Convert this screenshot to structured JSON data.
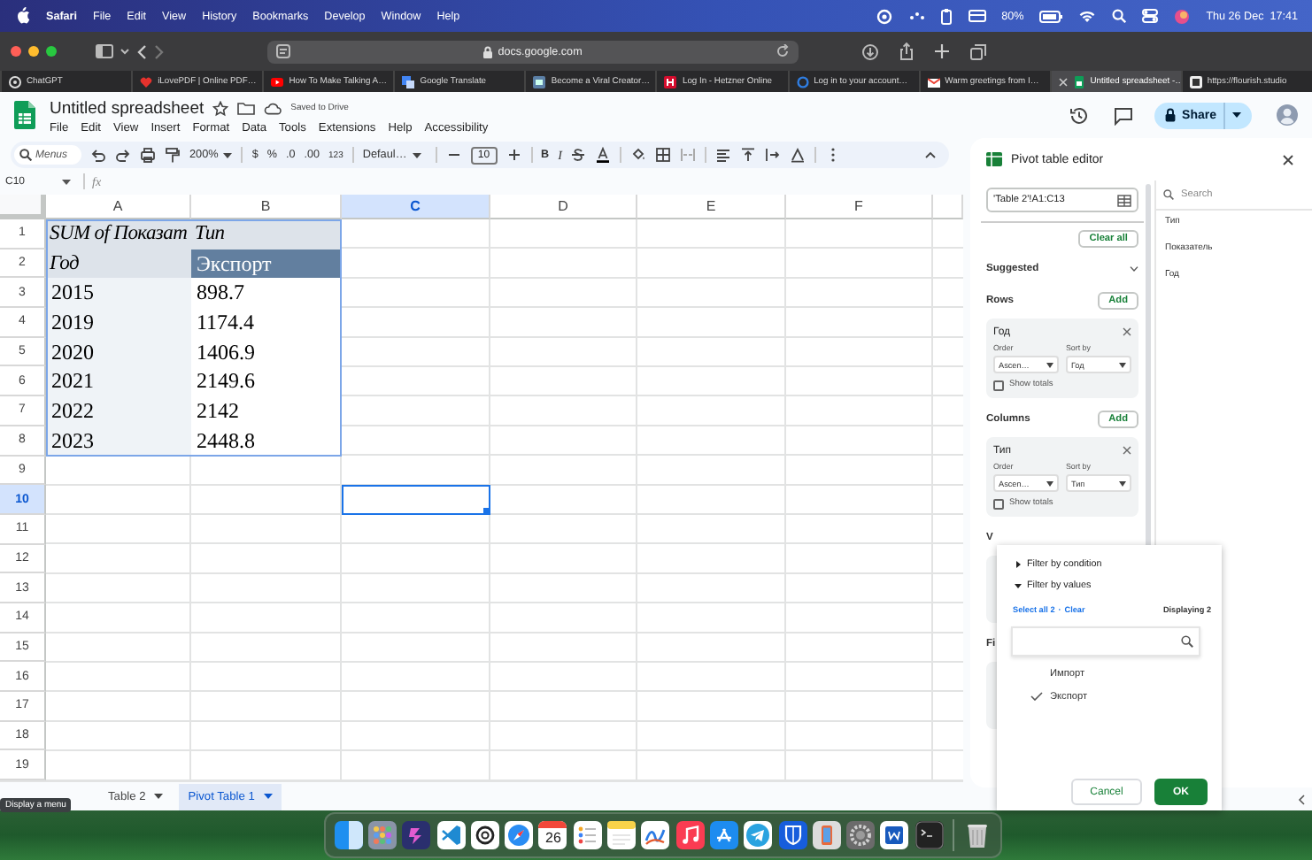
{
  "menu_bar": {
    "app": "Safari",
    "items": [
      "File",
      "Edit",
      "View",
      "History",
      "Bookmarks",
      "Develop",
      "Window",
      "Help"
    ],
    "battery": "80%",
    "clock": "Thu 26 Dec  17:41"
  },
  "browser": {
    "url": "docs.google.com",
    "tabs": [
      {
        "title": "ChatGPT",
        "selected": false
      },
      {
        "title": "iLovePDF | Online PDF…",
        "selected": false
      },
      {
        "title": "How To Make Talking A…",
        "selected": false
      },
      {
        "title": "Google Translate",
        "selected": false
      },
      {
        "title": "Become a Viral Creator…",
        "selected": false
      },
      {
        "title": "Log In - Hetzner Online",
        "selected": false
      },
      {
        "title": "Log in to your account…",
        "selected": false
      },
      {
        "title": "Warm greetings from I…",
        "selected": false
      },
      {
        "title": "Untitled spreadsheet -…",
        "selected": true
      },
      {
        "title": "https://flourish.studio",
        "selected": false
      }
    ]
  },
  "document": {
    "title": "Untitled spreadsheet",
    "save_status": "Saved to Drive",
    "menu": [
      "File",
      "Edit",
      "View",
      "Insert",
      "Format",
      "Data",
      "Tools",
      "Extensions",
      "Help",
      "Accessibility"
    ],
    "share": "Share"
  },
  "toolbar": {
    "search_placeholder": "Menus",
    "zoom": "200%",
    "currency": "$",
    "percent": "%",
    "decrease_decimals": ".0",
    "increase_decimals": ".00",
    "number_format": "123",
    "font": "Defaul…",
    "font_size": "10",
    "bold": "B",
    "italic": "I"
  },
  "formula_bar": {
    "cell_ref": "C10",
    "fx": "fx"
  },
  "grid": {
    "columns": [
      {
        "label": "A",
        "selected": false
      },
      {
        "label": "B",
        "selected": false
      },
      {
        "label": "C",
        "selected": true
      },
      {
        "label": "D",
        "selected": false
      },
      {
        "label": "E",
        "selected": false
      },
      {
        "label": "F",
        "selected": false
      }
    ],
    "rows": [
      {
        "label": "1",
        "selected": false
      },
      {
        "label": "2",
        "selected": false
      },
      {
        "label": "3",
        "selected": false
      },
      {
        "label": "4",
        "selected": false
      },
      {
        "label": "5",
        "selected": false
      },
      {
        "label": "6",
        "selected": false
      },
      {
        "label": "7",
        "selected": false
      },
      {
        "label": "8",
        "selected": false
      },
      {
        "label": "9",
        "selected": false
      },
      {
        "label": "10",
        "selected": true
      },
      {
        "label": "11",
        "selected": false
      },
      {
        "label": "12",
        "selected": false
      },
      {
        "label": "13",
        "selected": false
      },
      {
        "label": "14",
        "selected": false
      },
      {
        "label": "15",
        "selected": false
      },
      {
        "label": "16",
        "selected": false
      },
      {
        "label": "17",
        "selected": false
      },
      {
        "label": "18",
        "selected": false
      },
      {
        "label": "19",
        "selected": false
      }
    ],
    "pivot": [
      [
        "SUM of Показат",
        "Тип"
      ],
      [
        "Год",
        "Экспорт"
      ],
      [
        "2015",
        "898.7"
      ],
      [
        "2019",
        "1174.4"
      ],
      [
        "2020",
        "1406.9"
      ],
      [
        "2021",
        "2149.6"
      ],
      [
        "2022",
        "2142"
      ],
      [
        "2023",
        "2448.8"
      ]
    ]
  },
  "sheet_tabs": {
    "tooltip": "Display a menu",
    "tabs": [
      {
        "label": "Table 2",
        "selected": false
      },
      {
        "label": "Pivot Table 1",
        "selected": true
      }
    ]
  },
  "pivot_editor": {
    "title": "Pivot table editor",
    "range": "'Table 2'!A1:C13",
    "clear_all": "Clear all",
    "suggested": "Suggested",
    "sections": [
      {
        "label": "Rows",
        "add": "Add",
        "field": {
          "name": "Год",
          "order_label": "Order",
          "order": "Ascen…",
          "sort_label": "Sort by",
          "sort": "Год",
          "show_totals": "Show totals",
          "checked": false
        }
      },
      {
        "label": "Columns",
        "add": "Add",
        "field": {
          "name": "Тип",
          "order_label": "Order",
          "order": "Ascen…",
          "sort_label": "Sort by",
          "sort": "Тип",
          "show_totals": "Show totals",
          "checked": false
        }
      }
    ],
    "covered_sections": [
      "V",
      "Fi"
    ],
    "search_placeholder": "Search",
    "fields": [
      "Тип",
      "Показатель",
      "Год"
    ]
  },
  "filter_popup": {
    "options": [
      {
        "label": "Filter by condition",
        "expanded": false
      },
      {
        "label": "Filter by values",
        "expanded": true
      }
    ],
    "select_all": "Select all 2",
    "separator": "·",
    "clear": "Clear",
    "displaying": "Displaying 2",
    "values": [
      {
        "label": "Импорт",
        "checked": false
      },
      {
        "label": "Экспорт",
        "checked": true
      }
    ],
    "cancel": "Cancel",
    "ok": "OK"
  },
  "dock": {
    "calendar_date": "26"
  }
}
